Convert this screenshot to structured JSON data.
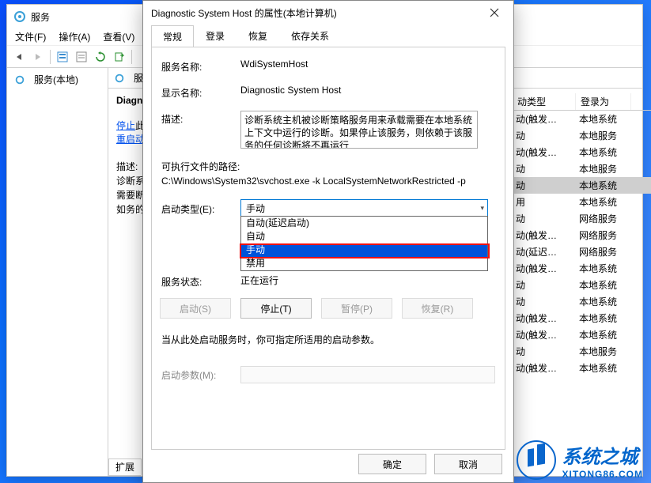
{
  "main_window": {
    "title": "服务",
    "menubar": [
      "文件(F)",
      "操作(A)",
      "查看(V)"
    ],
    "left_panel_item": "服务(本地)",
    "center_header": "服",
    "selected_service_name": "Diagn",
    "action_stop": "停止",
    "action_stop_suffix": "此",
    "action_restart": "重启动",
    "desc_label": "描述:",
    "desc_text": "诊断系载需要断。如务的任",
    "tabs_bottom": "扩展",
    "list_header_col1": "动类型",
    "list_header_col2": "登录为",
    "rows": [
      {
        "c1": "动(触发…",
        "c2": "本地系统",
        "hl": false
      },
      {
        "c1": "动",
        "c2": "本地服务",
        "hl": false
      },
      {
        "c1": "动(触发…",
        "c2": "本地系统",
        "hl": false
      },
      {
        "c1": "动",
        "c2": "本地服务",
        "hl": false
      },
      {
        "c1": "动",
        "c2": "本地系统",
        "hl": true
      },
      {
        "c1": "用",
        "c2": "本地系统",
        "hl": false
      },
      {
        "c1": "动",
        "c2": "网络服务",
        "hl": false
      },
      {
        "c1": "动(触发…",
        "c2": "网络服务",
        "hl": false
      },
      {
        "c1": "动(延迟…",
        "c2": "网络服务",
        "hl": false
      },
      {
        "c1": "动(触发…",
        "c2": "本地系统",
        "hl": false
      },
      {
        "c1": "动",
        "c2": "本地系统",
        "hl": false
      },
      {
        "c1": "动",
        "c2": "本地系统",
        "hl": false
      },
      {
        "c1": "动(触发…",
        "c2": "本地系统",
        "hl": false
      },
      {
        "c1": "动(触发…",
        "c2": "本地系统",
        "hl": false
      },
      {
        "c1": "动",
        "c2": "本地服务",
        "hl": false
      },
      {
        "c1": "动(触发…",
        "c2": "本地系统",
        "hl": false
      }
    ]
  },
  "dialog": {
    "title": "Diagnostic System Host 的属性(本地计算机)",
    "tabs": [
      "常规",
      "登录",
      "恢复",
      "依存关系"
    ],
    "labels": {
      "service_name": "服务名称:",
      "display_name": "显示名称:",
      "description": "描述:",
      "exe_path": "可执行文件的路径:",
      "startup_type": "启动类型(E):",
      "service_status": "服务状态:",
      "startup_params": "启动参数(M):"
    },
    "values": {
      "service_name": "WdiSystemHost",
      "display_name": "Diagnostic System Host",
      "description": "诊断系统主机被诊断策略服务用来承载需要在本地系统上下文中运行的诊断。如果停止该服务，则依赖于该服务的任何诊断将不再运行",
      "exe_path": "C:\\Windows\\System32\\svchost.exe -k LocalSystemNetworkRestricted -p",
      "startup_selected": "手动",
      "service_status": "正在运行"
    },
    "dropdown_options": [
      "自动(延迟启动)",
      "自动",
      "手动",
      "禁用"
    ],
    "buttons": {
      "start": "启动(S)",
      "stop": "停止(T)",
      "pause": "暂停(P)",
      "resume": "恢复(R)"
    },
    "note": "当从此处启动服务时，你可指定所适用的启动参数。",
    "ok": "确定",
    "cancel": "取消"
  },
  "watermark": {
    "main": "系统之城",
    "sub": "XITONG86.COM"
  }
}
